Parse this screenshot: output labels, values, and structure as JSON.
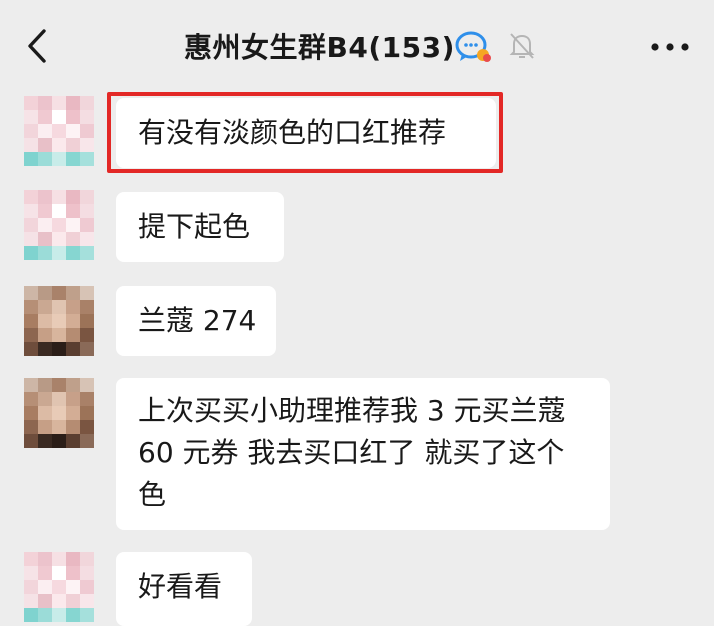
{
  "header": {
    "title": "惠州女生群B4(153)",
    "icons": [
      "chevron-left-icon",
      "group-chat-icon",
      "mute-bell-icon",
      "more-dots-icon"
    ]
  },
  "messages": [
    {
      "avatar": "pink-mosaic",
      "lines": [
        "有没有淡颜色的口红推荐"
      ],
      "highlighted": true
    },
    {
      "avatar": "pink-mosaic",
      "lines": [
        "提下起色"
      ]
    },
    {
      "avatar": "brown-mosaic",
      "lines": [
        "兰蔻 274"
      ]
    },
    {
      "avatar": "brown-mosaic",
      "lines": [
        "上次买买小助理推荐我 3 元买兰蔻",
        "60 元券 我去买口红了 就买了这个",
        "色"
      ]
    },
    {
      "avatar": "pink-mosaic",
      "lines": [
        "好看看"
      ]
    }
  ],
  "colors": {
    "background": "#ededed",
    "bubble": "#ffffff",
    "highlight_border": "#e32826",
    "group_icon_blue": "#2f8fea"
  }
}
